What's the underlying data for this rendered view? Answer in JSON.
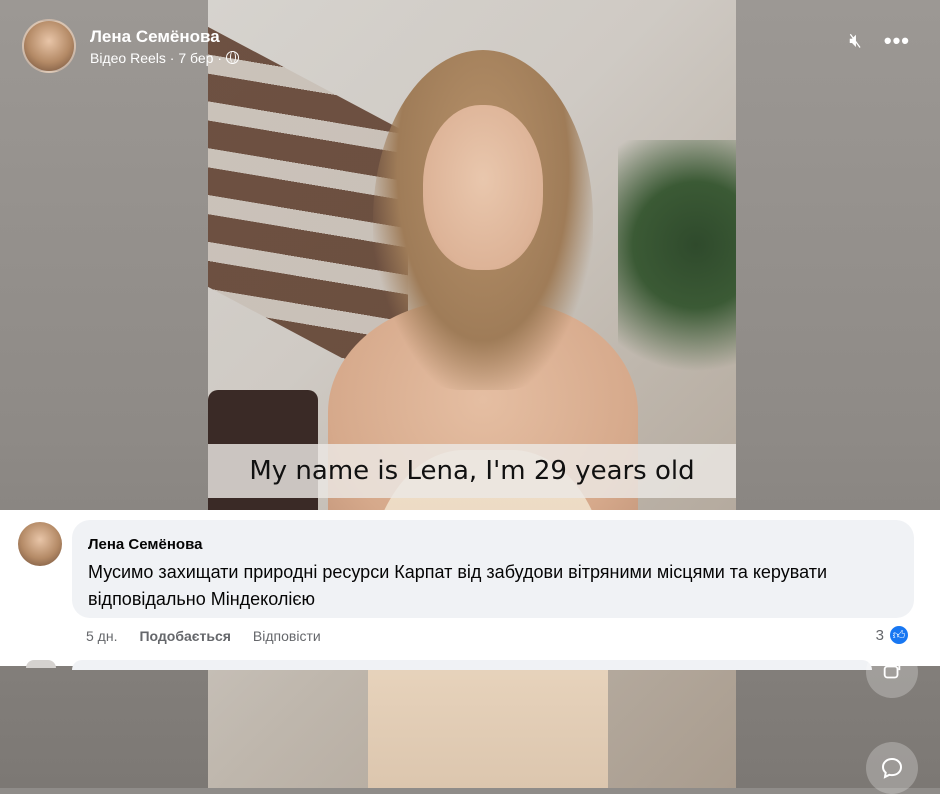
{
  "post": {
    "author": "Лена Семёнова",
    "meta": "Відео Reels · 7 бер ·",
    "subtitle": "My name is Lena, I'm 29 years old"
  },
  "controls": {
    "mute_icon": "🔇︎",
    "more_icon": "•••",
    "share_icon": "share-icon",
    "comment_icon": "comment-icon"
  },
  "comment": {
    "author": "Лена Семёнова",
    "text": "Мусимо захищати природні ресурси Карпат від забудови вітряними місцями та керувати відповідально Міндеколією",
    "time": "5 дн.",
    "like_label": "Подобається",
    "reply_label": "Відповісти",
    "reaction_count": "3"
  },
  "colors": {
    "accent": "#1877f2",
    "bubble": "#f0f2f5",
    "secondary_text": "#65676b"
  }
}
